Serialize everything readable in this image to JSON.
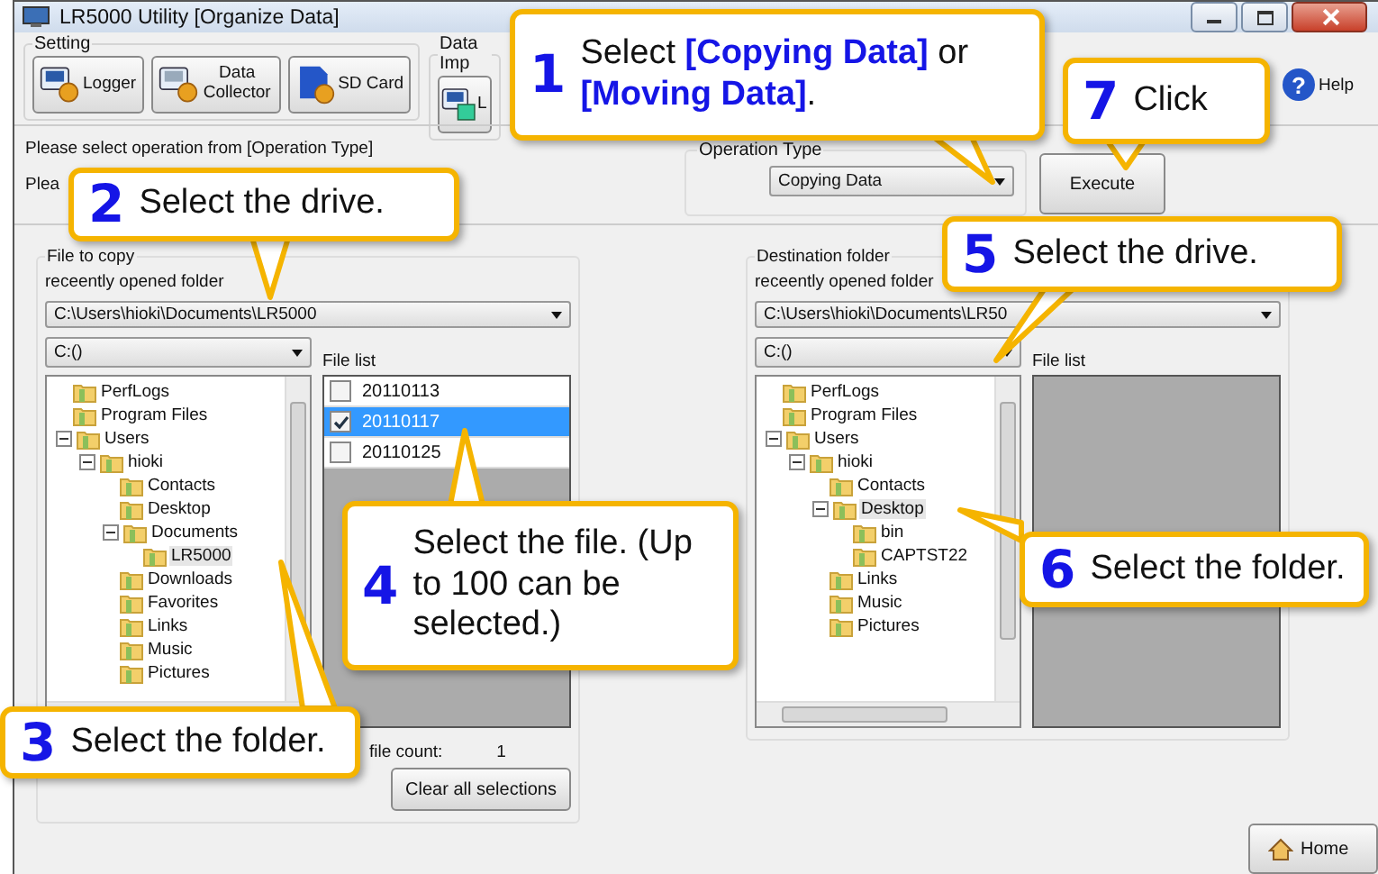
{
  "window": {
    "title": "LR5000 Utility [Organize Data]"
  },
  "toolbar": {
    "groups": [
      {
        "label": "Setting",
        "buttons": [
          {
            "kind": "logger",
            "label": "Logger"
          },
          {
            "kind": "collector",
            "label": "Data Collector"
          },
          {
            "kind": "sdcard",
            "label": "SD Card"
          }
        ]
      },
      {
        "label": "Data Imp",
        "buttons": [
          {
            "kind": "import",
            "label": "L"
          }
        ]
      }
    ],
    "help_icon": "?",
    "help_label": "Help"
  },
  "messages": [
    "Please select operation from [Operation Type]",
    "Plea"
  ],
  "operation_type": {
    "label": "Operation Type",
    "value": "Copying Data"
  },
  "execute_button": "Execute",
  "source_panel": {
    "title": "File to copy",
    "recent_label": "receently opened folder",
    "recent_path": "C:\\Users\\hioki\\Documents\\LR5000",
    "drive": "C:()",
    "file_list_label": "File list",
    "tree": [
      {
        "label": "PerfLogs",
        "selected": false
      },
      {
        "label": "Program Files",
        "selected": false
      },
      {
        "label": "Users",
        "selected": false,
        "expanded": true,
        "children": [
          {
            "label": "hioki",
            "selected": false,
            "expanded": true,
            "children": [
              {
                "label": "Contacts",
                "selected": false
              },
              {
                "label": "Desktop",
                "selected": false
              },
              {
                "label": "Documents",
                "selected": false,
                "expanded": true,
                "children": [
                  {
                    "label": "LR5000",
                    "selected": true
                  }
                ]
              },
              {
                "label": "Downloads",
                "selected": false
              },
              {
                "label": "Favorites",
                "selected": false
              },
              {
                "label": "Links",
                "selected": false
              },
              {
                "label": "Music",
                "selected": false
              },
              {
                "label": "Pictures",
                "selected": false
              }
            ]
          }
        ]
      }
    ],
    "files": [
      {
        "name": "20110113",
        "checked": false,
        "selected": false
      },
      {
        "name": "20110117",
        "checked": true,
        "selected": true
      },
      {
        "name": "20110125",
        "checked": false,
        "selected": false
      }
    ],
    "file_count_label": "file count:",
    "file_count": "1",
    "clear_button": "Clear all selections"
  },
  "destination_panel": {
    "title": "Destination folder",
    "recent_label": "receently opened folder",
    "recent_path": "C:\\Users\\hioki\\Documents\\LR50",
    "drive": "C:()",
    "file_list_label": "File list",
    "tree": [
      {
        "label": "PerfLogs",
        "selected": false
      },
      {
        "label": "Program Files",
        "selected": false
      },
      {
        "label": "Users",
        "selected": false,
        "expanded": true,
        "children": [
          {
            "label": "hioki",
            "selected": false,
            "expanded": true,
            "children": [
              {
                "label": "Contacts",
                "selected": false
              },
              {
                "label": "Desktop",
                "selected": true,
                "expanded": true,
                "children": [
                  {
                    "label": "bin",
                    "selected": false
                  },
                  {
                    "label": "CAPTST22",
                    "selected": false
                  }
                ]
              },
              {
                "label": "Links",
                "selected": false
              },
              {
                "label": "Music",
                "selected": false
              },
              {
                "label": "Pictures",
                "selected": false
              }
            ]
          }
        ]
      }
    ]
  },
  "home_button": "Home",
  "callouts": [
    {
      "number": "1",
      "text": "Select **[Copying Data]** or **[Moving Data]**."
    },
    {
      "number": "7",
      "text": "Click"
    },
    {
      "number": "2",
      "text": "Select the drive."
    },
    {
      "number": "5",
      "text": "Select the drive."
    },
    {
      "number": "4",
      "text": "Select the file. (Up to 100 can be selected.)"
    },
    {
      "number": "6",
      "text": "Select the folder."
    },
    {
      "number": "3",
      "text": "Select the folder."
    }
  ]
}
